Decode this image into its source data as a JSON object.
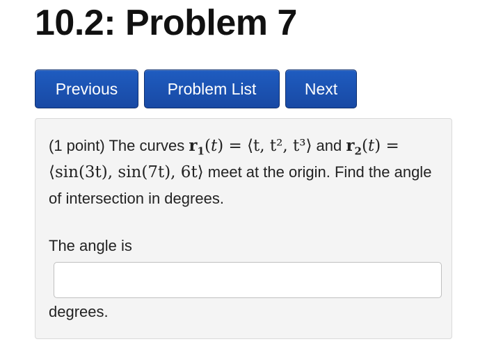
{
  "page": {
    "title": "10.2: Problem 7"
  },
  "nav": {
    "previous_label": "Previous",
    "problem_list_label": "Problem List",
    "next_label": "Next"
  },
  "problem": {
    "points": "(1 point)",
    "text_intro": "The curves",
    "text_and": "and",
    "text_meet": "meet at the origin. Find the angle of intersection in degrees.",
    "curve1": {
      "name": "r",
      "subscript": "1",
      "expression": "⟨t, t², t³⟩"
    },
    "curve2": {
      "name": "r",
      "subscript": "2",
      "expression": "⟨sin(3t), sin(7t), 6t⟩"
    },
    "answer_prompt": "The angle is",
    "answer_value": "",
    "answer_units": "degrees."
  },
  "colors": {
    "button_blue": "#1f5cc0",
    "box_background": "#f4f4f4"
  }
}
